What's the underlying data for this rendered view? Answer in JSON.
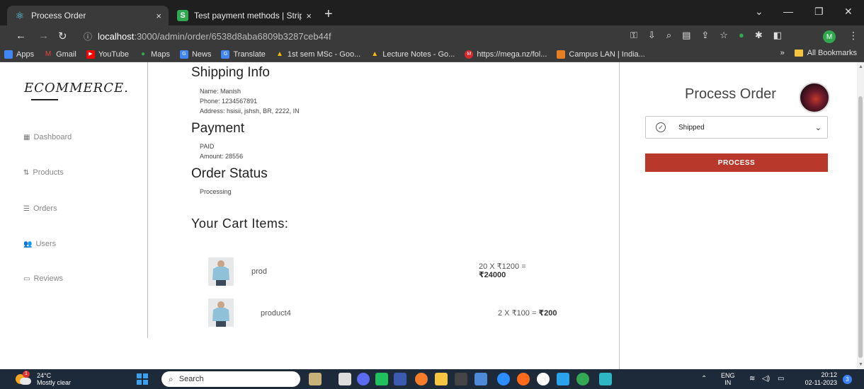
{
  "browser": {
    "tabs": [
      {
        "title": "Process Order",
        "close": "×"
      },
      {
        "title": "Test payment methods | Stripe D",
        "close": "×"
      }
    ],
    "new_tab": "+",
    "url_host": "localhost",
    "url_path": ":3000/admin/order/6538d8aba6809b3287ceb44f",
    "profile_initial": "M",
    "bookmarks": [
      {
        "label": "Apps",
        "icon_color": "#4285f4"
      },
      {
        "label": "Gmail",
        "icon_color": "#ea4335"
      },
      {
        "label": "YouTube",
        "icon_color": "#ff0000"
      },
      {
        "label": "Maps",
        "icon_color": "#34a853"
      },
      {
        "label": "News",
        "icon_color": "#4285f4"
      },
      {
        "label": "Translate",
        "icon_color": "#4285f4"
      },
      {
        "label": "1st sem MSc - Goo...",
        "icon_color": "#fbbc05"
      },
      {
        "label": "Lecture Notes - Go...",
        "icon_color": "#fbbc05"
      },
      {
        "label": "https://mega.nz/fol...",
        "icon_color": "#d9272e"
      },
      {
        "label": "Campus LAN | India...",
        "icon_color": "#e67e22"
      }
    ],
    "bookmarks_more": "»",
    "all_bookmarks": "All Bookmarks"
  },
  "sidebar": {
    "logo": "ECOMMERCE.",
    "items": [
      {
        "label": "Dashboard",
        "icon": "grid-icon"
      },
      {
        "label": "Products",
        "icon": "sort-icon"
      },
      {
        "label": "Orders",
        "icon": "list-icon"
      },
      {
        "label": "Users",
        "icon": "users-icon"
      },
      {
        "label": "Reviews",
        "icon": "review-icon"
      }
    ]
  },
  "shipping": {
    "title": "Shipping Info",
    "name_label": "Name:",
    "name": "Manish",
    "phone_label": "Phone:",
    "phone": "1234567891",
    "address_label": "Address:",
    "address": "hsisii, jshsh, BR, 2222, IN"
  },
  "payment": {
    "title": "Payment",
    "status": "PAID",
    "amount_label": "Amount:",
    "amount": "28556"
  },
  "order_status": {
    "title": "Order Status",
    "value": "Processing"
  },
  "cart": {
    "title": "Your Cart Items:",
    "items": [
      {
        "name": "prod",
        "calc": "20 X ₹1200 =",
        "total": "₹24000"
      },
      {
        "name": "product4",
        "calc": "2 X ₹100 =",
        "total": "₹200"
      }
    ]
  },
  "process_panel": {
    "title": "Process Order",
    "selected_status": "Shipped",
    "button_label": "PROCESS",
    "button_color": "#b8392b"
  },
  "taskbar": {
    "weather_temp": "24°C",
    "weather_desc": "Mostly clear",
    "weather_badge": "1",
    "search_placeholder": "Search",
    "lang_top": "ENG",
    "lang_bottom": "IN",
    "time": "20:12",
    "date": "02-11-2023",
    "notification_count": "3"
  }
}
